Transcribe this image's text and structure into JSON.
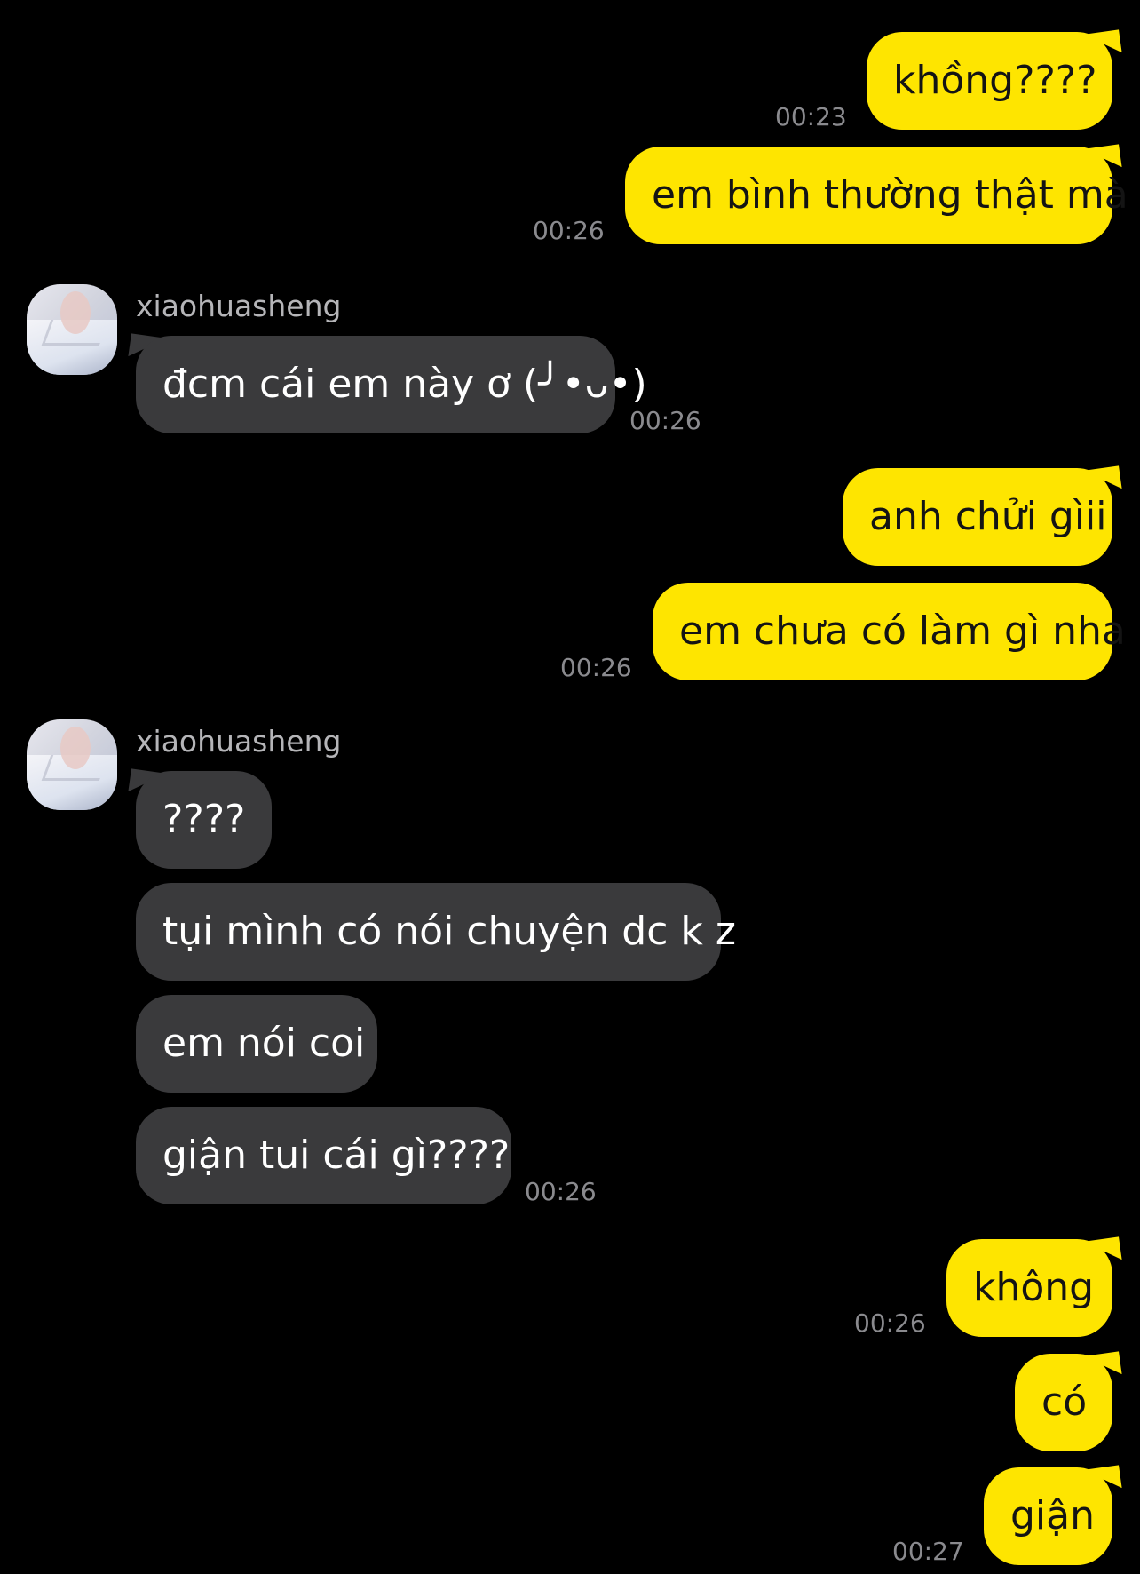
{
  "theme": {
    "background": "#000000",
    "outgoing_bubble": "#fee500",
    "incoming_bubble": "#3a3a3c",
    "timestamp_color": "#8a8a8e"
  },
  "messages": [
    {
      "direction": "out",
      "text": "khồng????",
      "time": "00:23"
    },
    {
      "direction": "out",
      "text": "em bình thường thật mà",
      "time": "00:26"
    },
    {
      "direction": "in",
      "sender": "xiaohuasheng",
      "text": "đcm cái em này ơ (╯•ᴗ•)",
      "time": "00:26"
    },
    {
      "direction": "out",
      "text": "anh chửi gìii"
    },
    {
      "direction": "out",
      "text": "em chưa có làm gì nha",
      "time": "00:26"
    },
    {
      "direction": "in",
      "sender": "xiaohuasheng",
      "text": "????"
    },
    {
      "direction": "in",
      "text": "tụi mình có nói chuyện dc k z"
    },
    {
      "direction": "in",
      "text": "em nói coi"
    },
    {
      "direction": "in",
      "text": "giận tui cái gì????",
      "time": "00:26"
    },
    {
      "direction": "out",
      "text": "không",
      "time": "00:26"
    },
    {
      "direction": "out",
      "text": "có"
    },
    {
      "direction": "out",
      "text": "giận",
      "time": "00:27"
    }
  ]
}
